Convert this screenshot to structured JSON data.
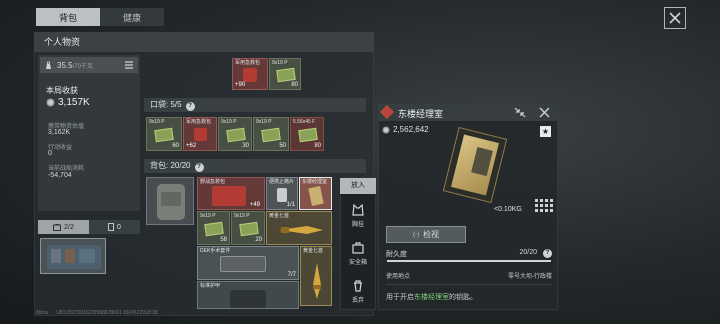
{
  "tabs": [
    {
      "label": "背包"
    },
    {
      "label": "健康"
    }
  ],
  "panel_title": "个人物资",
  "weight": {
    "value": "35.5",
    "unit": "/70千克"
  },
  "stats": {
    "income_label": "本局收获",
    "income_value": "3,157K",
    "carry_label": "携带物资估值",
    "carry_value": "3,162K",
    "action_label": "行动收益",
    "action_value": "0",
    "cost_label": "当前战局消耗",
    "cost_value": "-54,704"
  },
  "pouch": {
    "label": "口袋:",
    "count": "5/5"
  },
  "backpack": {
    "label": "背包:",
    "count": "20/20"
  },
  "equip_tabs": [
    {
      "label": "2/2"
    },
    {
      "label": "0"
    }
  ],
  "top_slots": [
    {
      "label": "军用急救包",
      "count": "+90"
    },
    {
      "label": "9x19 P",
      "count": "80"
    }
  ],
  "pouch_slots": [
    {
      "label": "9x19 P",
      "count": "60"
    },
    {
      "label": "军用急救包",
      "count": "+62"
    },
    {
      "label": "9x19 P",
      "count": "30"
    },
    {
      "label": "9x19 P",
      "count": "50"
    },
    {
      "label": "5.56x45 F",
      "count": "80"
    }
  ],
  "bag_slots": [
    {
      "label": "野战急救包",
      "count": "+49"
    },
    {
      "label": "便携止痛片",
      "count": "1/1"
    },
    {
      "label": "东楼经理室",
      "count": ""
    },
    {
      "label": "9x19 P",
      "count": "58"
    },
    {
      "label": "9x19 P",
      "count": "20"
    },
    {
      "label": "黄金匕首",
      "count": ""
    },
    {
      "label": "DEK手术套件",
      "count": "7/7"
    },
    {
      "label": "黄金匕首",
      "count": ""
    },
    {
      "label": "标准护甲",
      "count": ""
    }
  ],
  "context_menu": {
    "header": "放入",
    "items": [
      {
        "label": "胸挂"
      },
      {
        "label": "安全箱"
      },
      {
        "label": "丢弃"
      }
    ]
  },
  "detail": {
    "title": "东楼经理室",
    "price": "2,562,642",
    "weight": "<0.10KG",
    "inspect_label": "检视",
    "durability_label": "耐久度",
    "durability_value": "20/20",
    "location_label": "使用地点",
    "location_value": "零号大坝-行政楼",
    "desc_prefix": "用于开启",
    "desc_highlight": "东楼经理室",
    "desc_suffix": "的钥匙。"
  },
  "footer": {
    "ping": "80ms",
    "session": "UID:20270911229568878661 2024122918:38"
  },
  "icons": [
    "close-icon",
    "weight-icon",
    "list-icon",
    "coin-icon",
    "vest-icon",
    "safebox-icon",
    "trash-icon",
    "star-icon",
    "grid-icon",
    "collapse-icon"
  ],
  "colors": {
    "accent_red": "#b8453e",
    "highlight_green": "#7fd37a"
  }
}
